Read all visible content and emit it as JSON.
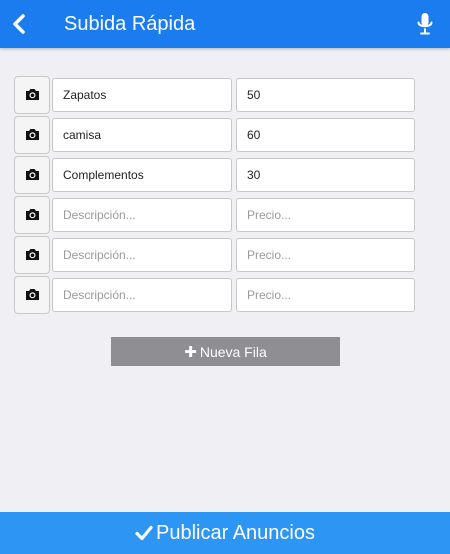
{
  "header": {
    "title": "Subida Rápida",
    "back_icon": "chevron-left-icon",
    "mic_icon": "microphone-icon",
    "background": "#1b7cf0"
  },
  "rows": [
    {
      "description": "Zapatos",
      "price": "50",
      "description_placeholder": "Descripción...",
      "price_placeholder": "Precio..."
    },
    {
      "description": "camisa",
      "price": "60",
      "description_placeholder": "Descripción...",
      "price_placeholder": "Precio..."
    },
    {
      "description": "Complementos",
      "price": "30",
      "description_placeholder": "Descripción...",
      "price_placeholder": "Precio..."
    },
    {
      "description": "",
      "price": "",
      "description_placeholder": "Descripción...",
      "price_placeholder": "Precio..."
    },
    {
      "description": "",
      "price": "",
      "description_placeholder": "Descripción...",
      "price_placeholder": "Precio..."
    },
    {
      "description": "",
      "price": "",
      "description_placeholder": "Descripción...",
      "price_placeholder": "Precio..."
    }
  ],
  "new_row_button": {
    "icon": "plus-icon",
    "label": "Nueva Fila",
    "color": "#8e8e93"
  },
  "publish_button": {
    "icon": "check-icon",
    "label": "Publicar Anuncios",
    "color": "#2d96f5"
  }
}
